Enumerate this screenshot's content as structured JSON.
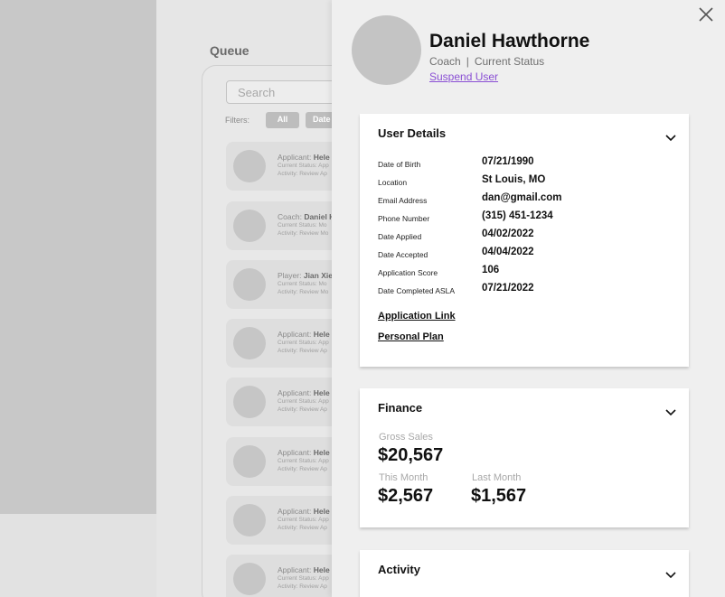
{
  "queue": {
    "title": "Queue",
    "search_placeholder": "Search",
    "filters_label": "Filters:",
    "filters": [
      "All",
      "Date"
    ],
    "cards": [
      {
        "role": "Applicant:",
        "name": "Hele",
        "status": "Current Status: App",
        "activity": "Activity: Review Ap"
      },
      {
        "role": "Coach:",
        "name": "Daniel H",
        "status": "Current Status: Mo",
        "activity": "Activity: Review Mo"
      },
      {
        "role": "Player:",
        "name": "Jian Xie",
        "status": "Current Status: Mo",
        "activity": "Activity: Review Mo"
      },
      {
        "role": "Applicant:",
        "name": "Hele",
        "status": "Current Status: App",
        "activity": "Activity: Review Ap"
      },
      {
        "role": "Applicant:",
        "name": "Hele",
        "status": "Current Status: App",
        "activity": "Activity: Review Ap"
      },
      {
        "role": "Applicant:",
        "name": "Hele",
        "status": "Current Status: App",
        "activity": "Activity: Review Ap"
      },
      {
        "role": "Applicant:",
        "name": "Hele",
        "status": "Current Status: App",
        "activity": "Activity: Review Ap"
      },
      {
        "role": "Applicant:",
        "name": "Hele",
        "status": "Current Status: App",
        "activity": "Activity: Review Ap"
      }
    ]
  },
  "profile": {
    "name": "Daniel Hawthorne",
    "role": "Coach",
    "separator": "|",
    "status": "Current Status",
    "suspend_label": "Suspend User"
  },
  "user_details": {
    "title": "User Details",
    "rows": [
      {
        "label": "Date of Birth",
        "value": "07/21/1990"
      },
      {
        "label": "Location",
        "value": "St Louis, MO"
      },
      {
        "label": "Email Address",
        "value": "dan@gmail.com"
      },
      {
        "label": "Phone Number",
        "value": "(315) 451-1234"
      },
      {
        "label": "Date Applied",
        "value": "04/02/2022"
      },
      {
        "label": "Date Accepted",
        "value": "04/04/2022"
      },
      {
        "label": "Application Score",
        "value": "106"
      },
      {
        "label": "Date Completed ASLA",
        "value": "07/21/2022"
      }
    ],
    "application_link": "Application Link",
    "personal_plan": "Personal Plan"
  },
  "finance": {
    "title": "Finance",
    "gross_label": "Gross Sales",
    "gross_value": "$20,567",
    "this_month_label": "This Month",
    "this_month_value": "$2,567",
    "last_month_label": "Last Month",
    "last_month_value": "$1,567"
  },
  "activity": {
    "title": "Activity"
  }
}
